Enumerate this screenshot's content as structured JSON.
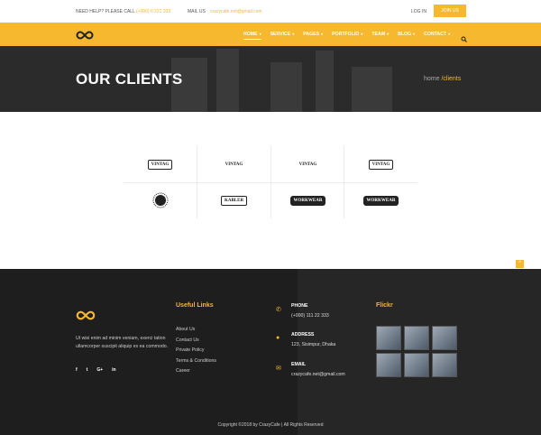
{
  "topbar": {
    "help_label": "NEED HELP? PLEASE CALL",
    "phone": "(+000) 0 222 333",
    "mail_label": "MAIL US",
    "email": "crazycafe.net@gmail.com",
    "login": "LOG IN",
    "join": "JOIN US"
  },
  "nav": {
    "items": [
      {
        "label": "HOME",
        "dropdown": true
      },
      {
        "label": "SERVICE",
        "dropdown": true
      },
      {
        "label": "PAGES",
        "dropdown": true
      },
      {
        "label": "PORTFOLIO",
        "dropdown": true
      },
      {
        "label": "TEAM",
        "dropdown": true
      },
      {
        "label": "BLOG",
        "dropdown": true
      },
      {
        "label": "CONTACT",
        "dropdown": true
      }
    ],
    "search_icon": "search-icon"
  },
  "hero": {
    "title": "OUR CLIENTS",
    "breadcrumb_home": "home",
    "breadcrumb_current": "/clients"
  },
  "clients": {
    "logos": [
      {
        "text": "VINTAG",
        "style": "box"
      },
      {
        "text": "VINTAG",
        "style": "plain"
      },
      {
        "text": "VINTAG",
        "style": "plain"
      },
      {
        "text": "VINTAG",
        "style": "box"
      },
      {
        "text": "",
        "style": "emblem"
      },
      {
        "text": "KABLER",
        "style": "box"
      },
      {
        "text": "WORKWEAR",
        "style": "dark"
      },
      {
        "text": "WORKWEAR",
        "style": "dark"
      }
    ]
  },
  "footer": {
    "about": "Ut wisi enim ad minim veniam, exerci tation ullamcorper suscipit aliquip ex ea commodo.",
    "social": [
      "f",
      "t",
      "G+",
      "in"
    ],
    "useful_links_title": "Useful Links",
    "links": [
      "About Us",
      "Contact Us",
      "Private Policy",
      "Terms & Conditions",
      "Career"
    ],
    "contact": {
      "phone_title": "PHONE",
      "phone": "(+000) 111 22 333",
      "address_title": "ADDRESS",
      "address": "123, Sisimpur, Dhaka",
      "email_title": "EMAIL",
      "email": "crazycafe.net@gmail.com"
    },
    "flickr_title": "Flickr",
    "copyright": "Copyright ©2018 by CrazyCafe  |  All Rights Reserved"
  },
  "colors": {
    "accent": "#f5b82e",
    "dark": "#1e1e1e"
  }
}
